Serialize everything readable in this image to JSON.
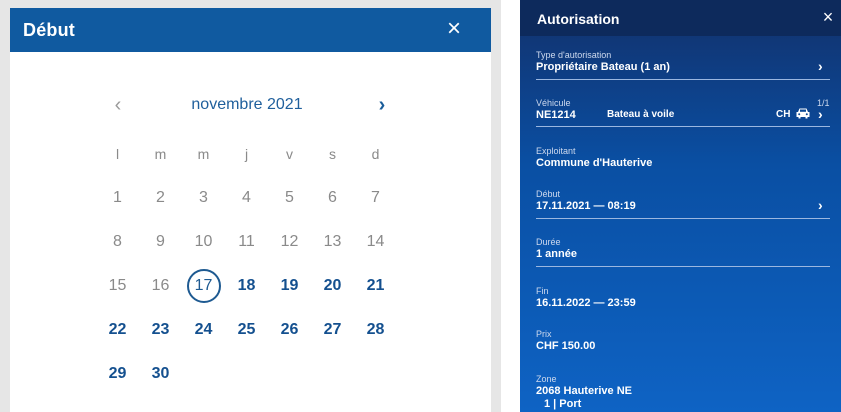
{
  "picker": {
    "title": "Début",
    "close_icon": "×",
    "month_label": "novembre 2021",
    "prev_icon": "‹",
    "next_icon": "›",
    "weekdays": [
      "l",
      "m",
      "m",
      "j",
      "v",
      "s",
      "d"
    ],
    "days": [
      {
        "label": "1",
        "active": false
      },
      {
        "label": "2",
        "active": false
      },
      {
        "label": "3",
        "active": false
      },
      {
        "label": "4",
        "active": false
      },
      {
        "label": "5",
        "active": false
      },
      {
        "label": "6",
        "active": false
      },
      {
        "label": "7",
        "active": false
      },
      {
        "label": "8",
        "active": false
      },
      {
        "label": "9",
        "active": false
      },
      {
        "label": "10",
        "active": false
      },
      {
        "label": "11",
        "active": false
      },
      {
        "label": "12",
        "active": false
      },
      {
        "label": "13",
        "active": false
      },
      {
        "label": "14",
        "active": false
      },
      {
        "label": "15",
        "active": false
      },
      {
        "label": "16",
        "active": false
      },
      {
        "label": "17",
        "active": true,
        "selected": true
      },
      {
        "label": "18",
        "active": true
      },
      {
        "label": "19",
        "active": true
      },
      {
        "label": "20",
        "active": true
      },
      {
        "label": "21",
        "active": true
      },
      {
        "label": "22",
        "active": true
      },
      {
        "label": "23",
        "active": true
      },
      {
        "label": "24",
        "active": true
      },
      {
        "label": "25",
        "active": true
      },
      {
        "label": "26",
        "active": true
      },
      {
        "label": "27",
        "active": true
      },
      {
        "label": "28",
        "active": true
      },
      {
        "label": "29",
        "active": true
      },
      {
        "label": "30",
        "active": true
      }
    ],
    "colors": {
      "header": "#105aa0",
      "active_day": "#14508f",
      "inactive_day": "#8a8a8a"
    }
  },
  "auth": {
    "title": "Autorisation",
    "close_icon": "×",
    "chevron": "›",
    "type": {
      "label": "Type d'autorisation",
      "value": "Propriétaire Bateau (1 an)"
    },
    "vehicle": {
      "label": "Véhicule",
      "count": "1/1",
      "plate": "NE1214",
      "kind": "Bateau à voile",
      "country": "CH",
      "icon": "car-icon"
    },
    "operator": {
      "label": "Exploitant",
      "value": "Commune d'Hauterive"
    },
    "start": {
      "label": "Début",
      "value": "17.11.2021 — 08:19"
    },
    "duration": {
      "label": "Durée",
      "value": "1 année"
    },
    "end": {
      "label": "Fin",
      "value": "16.11.2022 — 23:59"
    },
    "price": {
      "label": "Prix",
      "value": "CHF 150.00"
    },
    "zone": {
      "label": "Zone",
      "value": "2068 Hauterive NE",
      "sub": "1 | Port"
    },
    "colors": {
      "header": "#0d2a5c",
      "gradient_top": "#12306a",
      "gradient_bottom": "#0e63c4"
    }
  }
}
